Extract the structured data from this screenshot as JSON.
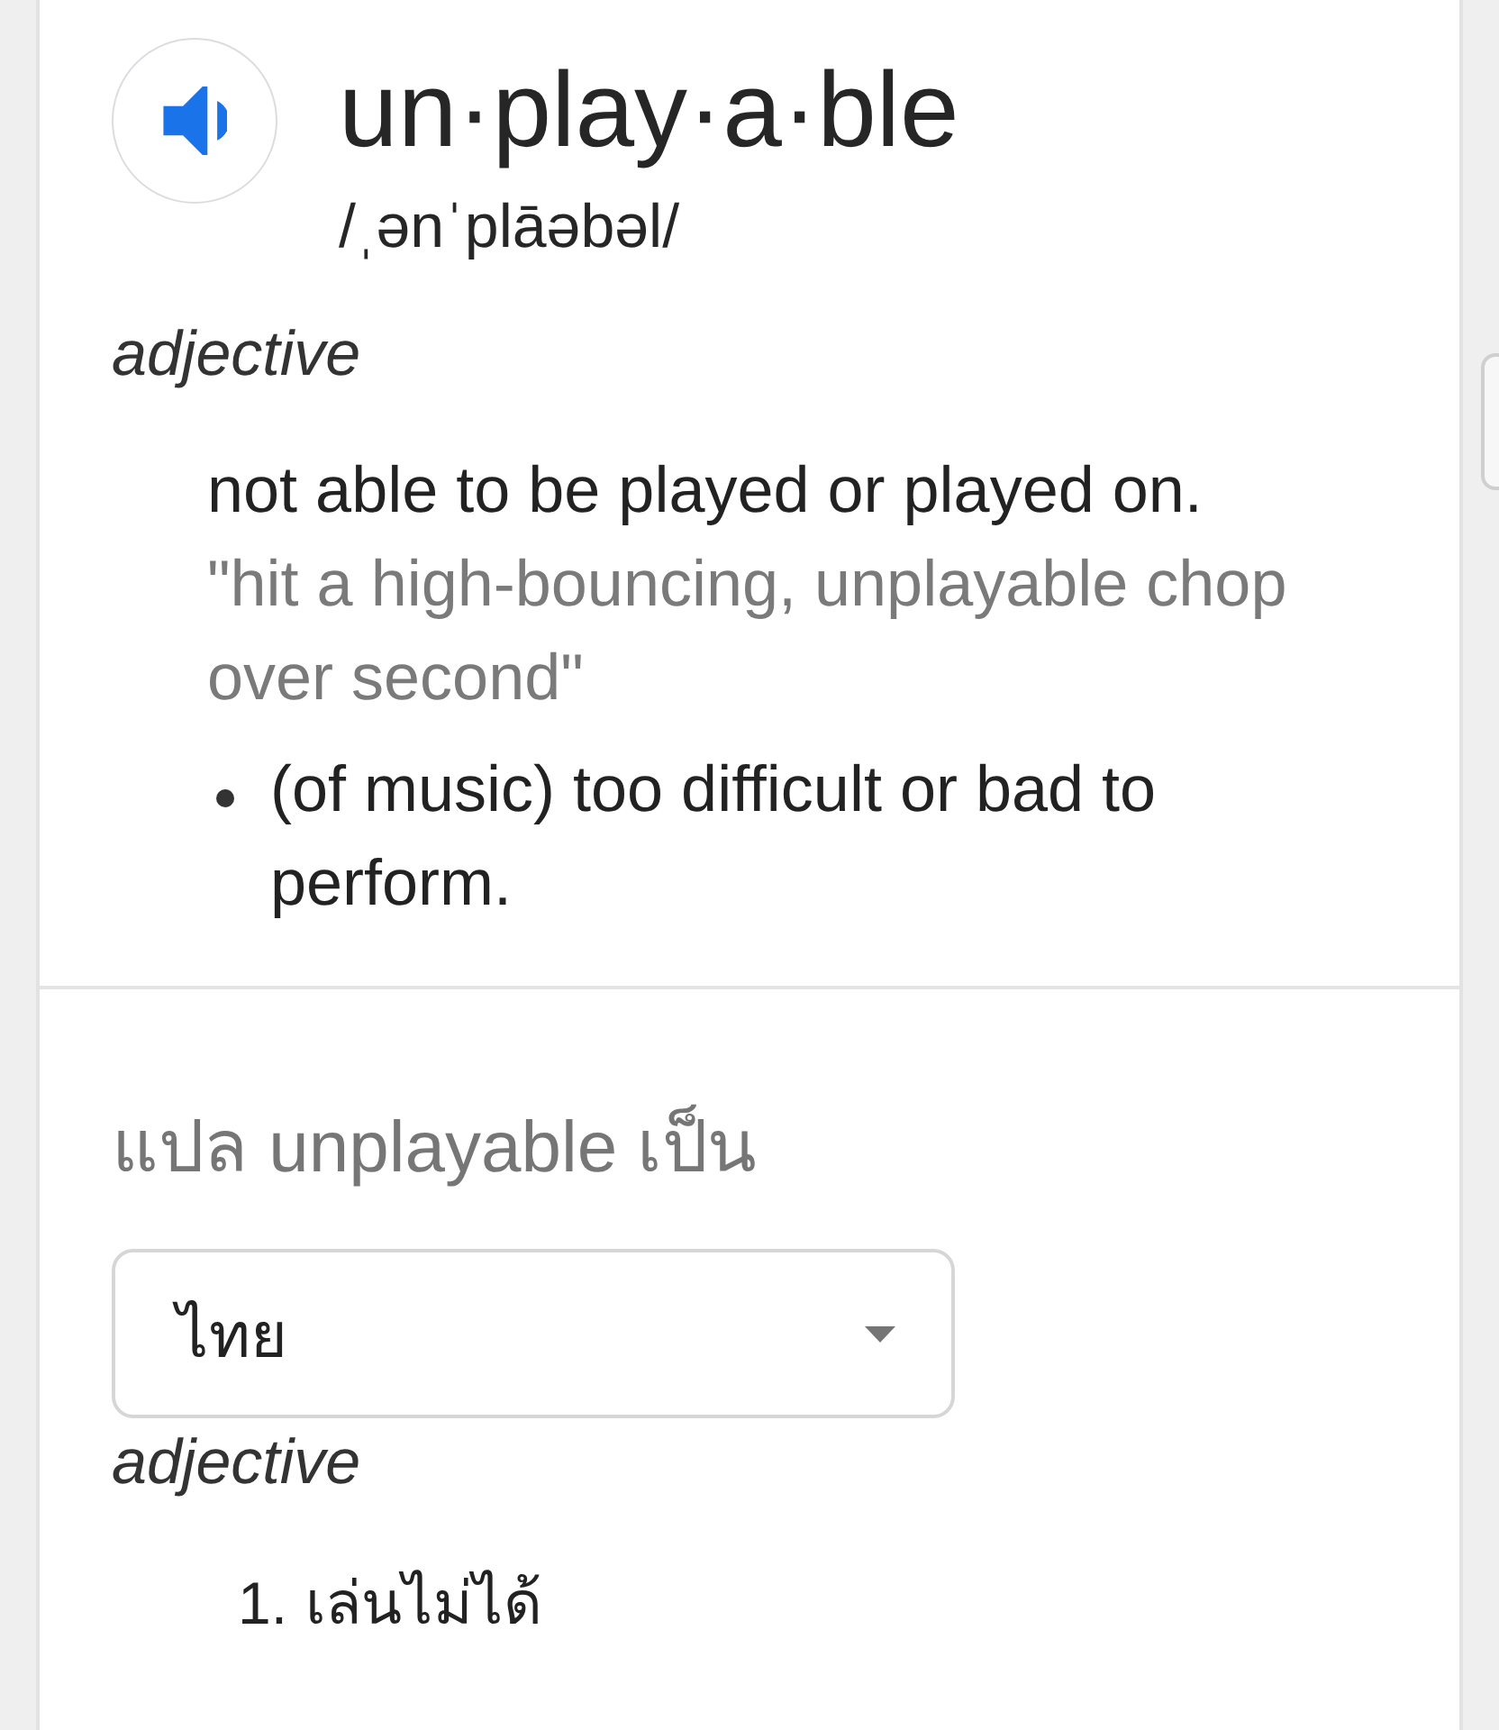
{
  "entry": {
    "headword": "un·play·a·ble",
    "phonetic": "/ˌənˈplāəbəl/"
  },
  "senses": [
    {
      "part_of_speech": "adjective",
      "definitions": [
        {
          "text": "not able to be played or played on.",
          "example": "\"hit a high-bouncing, unplayable chop over second\"",
          "subsenses": [
            "(of music) too difficult or bad to perform."
          ]
        }
      ]
    }
  ],
  "translation": {
    "heading": "แปล unplayable เป็น",
    "language_select": {
      "value": "ไทย"
    },
    "part_of_speech": "adjective",
    "meanings": [
      {
        "number": "1.",
        "text": "เล่นไม่ได้"
      }
    ]
  }
}
